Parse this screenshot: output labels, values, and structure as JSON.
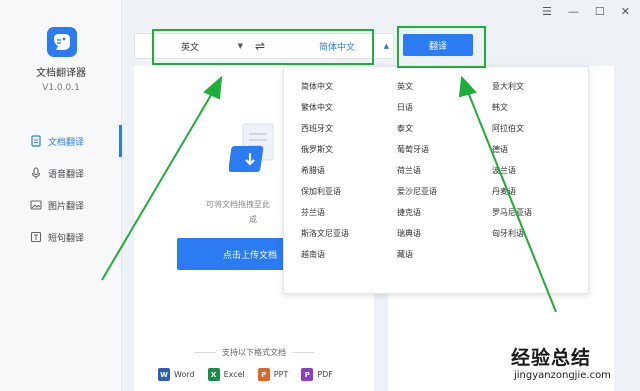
{
  "window": {
    "minimize": "—",
    "maximize": "☐",
    "close": "✕",
    "menu": "☰"
  },
  "sidebar": {
    "app_name": "文档翻译器",
    "version": "V1.0.0.1",
    "items": [
      {
        "label": "文档翻译",
        "icon": "document-icon",
        "active": true
      },
      {
        "label": "语音翻译",
        "icon": "microphone-icon",
        "active": false
      },
      {
        "label": "图片翻译",
        "icon": "image-icon",
        "active": false
      },
      {
        "label": "短句翻译",
        "icon": "text-icon",
        "active": false
      }
    ]
  },
  "lang_bar": {
    "source": "英文",
    "swap": "⇌",
    "target": "简体中文",
    "caret": "▼",
    "caret_up": "▲"
  },
  "translate_button": "翻译",
  "upload": {
    "hint": "可将文档拖拽至此",
    "or": "或",
    "button": "点击上传文档",
    "formats_title": "支持以下格式文档",
    "formats": [
      {
        "label": "Word",
        "color": "#2b5fb8",
        "glyph": "W"
      },
      {
        "label": "Excel",
        "color": "#1e8a4a",
        "glyph": "X"
      },
      {
        "label": "PPT",
        "color": "#e0642a",
        "glyph": "P"
      },
      {
        "label": "PDF",
        "color": "#8a3dc9",
        "glyph": "P"
      }
    ]
  },
  "dropdown": {
    "columns": [
      [
        "简体中文",
        "繁体中文",
        "西班牙文",
        "俄罗斯文",
        "希腊语",
        "保加利亚语",
        "芬兰语",
        "斯洛文尼亚语",
        "越南语"
      ],
      [
        "英文",
        "日语",
        "泰文",
        "葡萄牙语",
        "荷兰语",
        "爱沙尼亚语",
        "捷克语",
        "瑞典语",
        "藏语"
      ],
      [
        "意大利文",
        "韩文",
        "阿拉伯文",
        "德语",
        "波兰语",
        "丹麦语",
        "罗马尼亚语",
        "匈牙利语"
      ]
    ]
  },
  "colors": {
    "accent": "#2b7cf2",
    "highlight": "#1fae3c"
  },
  "watermark": {
    "cn": "经验总结",
    "en": "jingyanzongjie.com"
  }
}
